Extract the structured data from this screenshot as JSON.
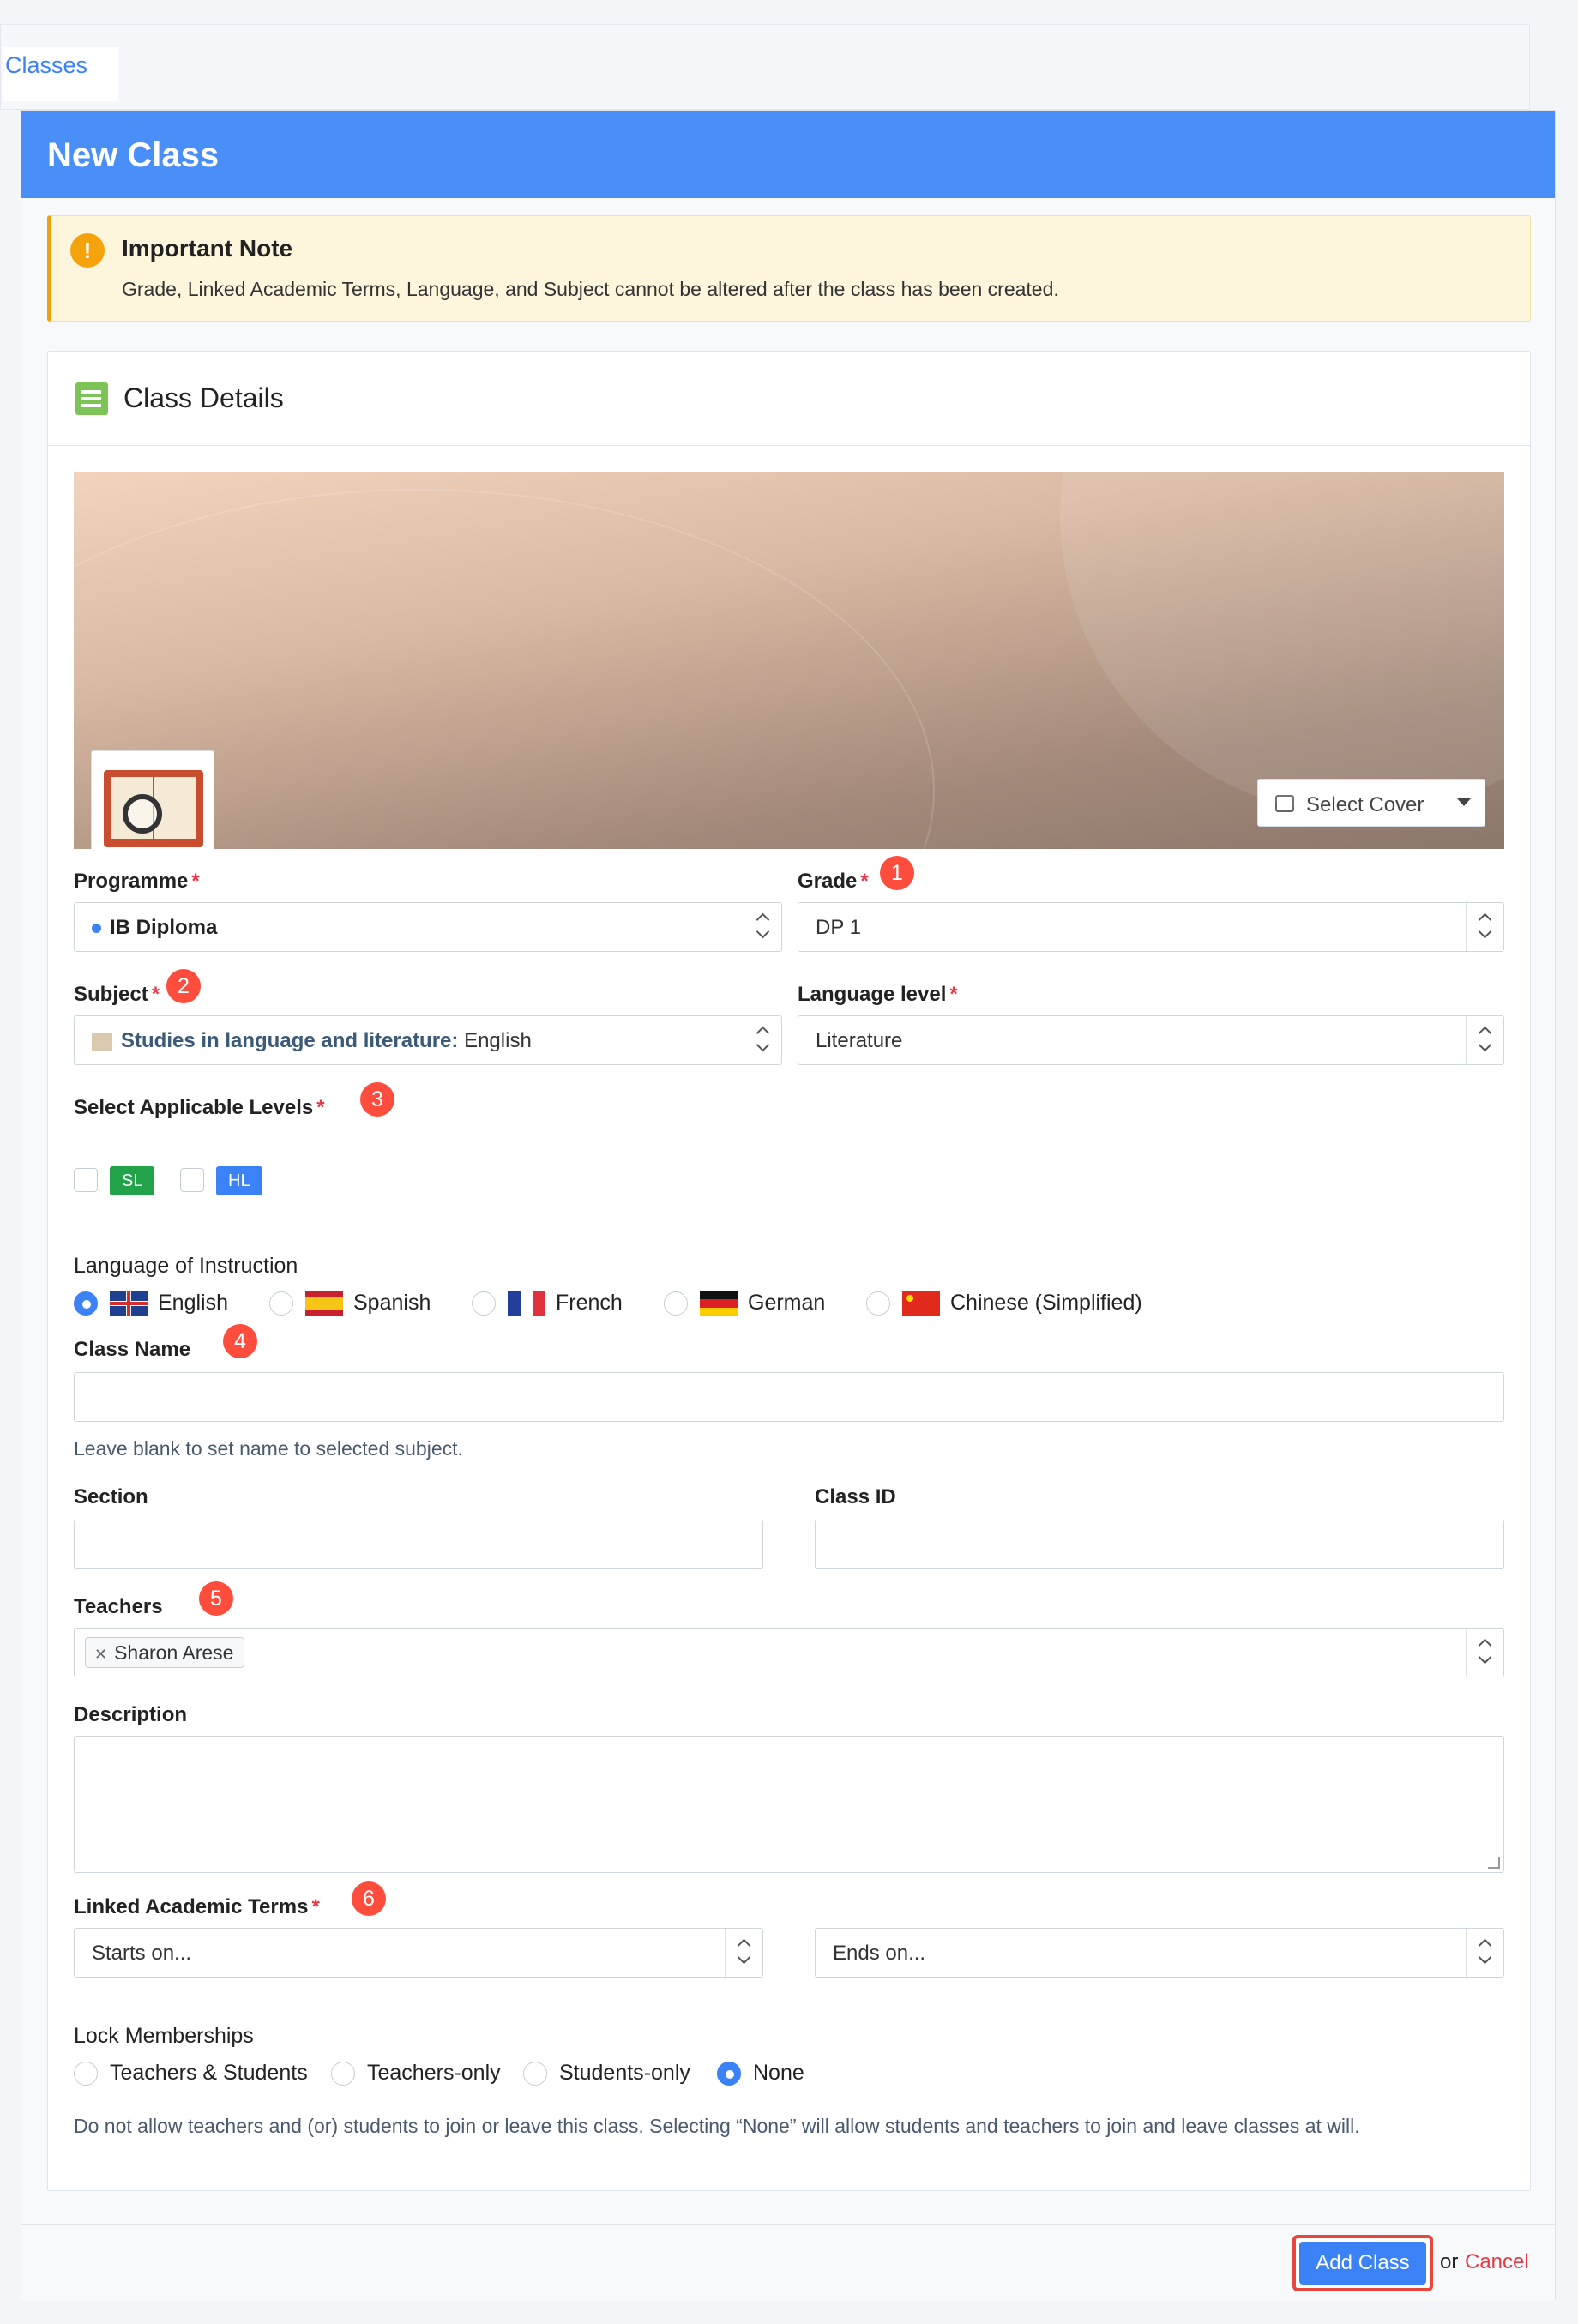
{
  "breadcrumb": {
    "classes": "Classes"
  },
  "header": {
    "title": "New Class"
  },
  "note": {
    "title": "Important Note",
    "body": "Grade, Linked Academic Terms, Language, and Subject cannot be altered after the class has been created.",
    "icon": "exclamation-icon"
  },
  "card": {
    "title": "Class Details",
    "icon": "notepad-icon"
  },
  "cover": {
    "select_label": "Select Cover",
    "icon": "image-icon"
  },
  "form": {
    "programme": {
      "label": "Programme",
      "value": "IB Diploma"
    },
    "grade": {
      "label": "Grade",
      "value": "DP 1",
      "badge": "1"
    },
    "subject": {
      "label": "Subject",
      "badge": "2",
      "group": "Studies in language and literature:",
      "value": "English"
    },
    "language_level": {
      "label": "Language level",
      "value": "Literature"
    },
    "levels": {
      "label": "Select Applicable Levels",
      "badge": "3",
      "options": [
        "SL",
        "HL"
      ]
    },
    "instruction": {
      "label": "Language of Instruction",
      "options": [
        "English",
        "Spanish",
        "French",
        "German",
        "Chinese (Simplified)"
      ],
      "selected": "English"
    },
    "class_name": {
      "label": "Class Name",
      "badge": "4",
      "value": "",
      "help": "Leave blank to set name to selected subject."
    },
    "section": {
      "label": "Section",
      "value": ""
    },
    "class_id": {
      "label": "Class ID",
      "value": ""
    },
    "teachers": {
      "label": "Teachers",
      "badge": "5",
      "chips": [
        "Sharon Arese"
      ]
    },
    "description": {
      "label": "Description",
      "value": ""
    },
    "terms": {
      "label": "Linked Academic Terms",
      "badge": "6",
      "start_placeholder": "Starts on...",
      "end_placeholder": "Ends on..."
    },
    "lock": {
      "label": "Lock Memberships",
      "options": [
        "Teachers & Students",
        "Teachers-only",
        "Students-only",
        "None"
      ],
      "selected": "None",
      "help": "Do not allow teachers and (or) students to join or leave this class. Selecting “None” will allow students and teachers to join and leave classes at will."
    }
  },
  "footer": {
    "add_label": "Add Class",
    "or_text": "or",
    "cancel_label": "Cancel"
  },
  "colors": {
    "primary": "#4a8ff7",
    "danger": "#e63946",
    "sl": "#22a34a",
    "hl": "#3b82f6",
    "warning": "#f4a30c"
  }
}
